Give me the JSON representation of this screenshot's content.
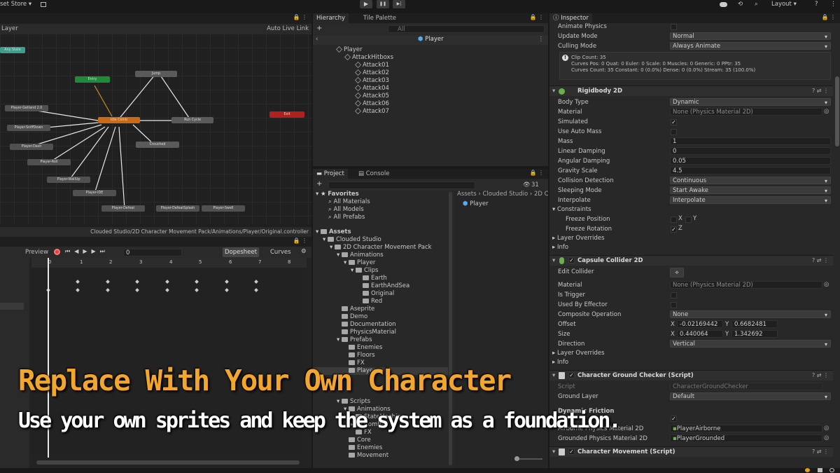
{
  "topbar": {
    "asset_store": "set Store ▾",
    "layout": "Layout ▾",
    "play_glyph": "▶",
    "pause_glyph": "❚❚",
    "step_glyph": "▶|"
  },
  "animator": {
    "layer_label": "Layer",
    "auto_live_link": "Auto Live Link",
    "path": "Clouded Studio/2D Character Movement Pack/Animations/Player/Original.controller",
    "nodes": {
      "any_state": "Any State",
      "entry": "Entry",
      "exit": "Exit",
      "idle": "Idle Comb",
      "jump": "Jump",
      "run_cycle": "Run Cycle",
      "crouched": "Crouched",
      "player_getdamaged": "Player-Getland 2.0",
      "player_sniffdown": "Player-SniffDown",
      "player_dash": "Player-Dash",
      "player_roll": "Player-Roll",
      "player_wallup": "Player-WallUp",
      "player_idle": "Player-IDE",
      "player_defeat": "Player-Defeat",
      "player_defeatsplash": "Player-DefeatSplash",
      "player_swell": "Player-Swell"
    }
  },
  "animation": {
    "preview_label": "Preview",
    "frame_value": "0",
    "dopesheet_label": "Dopesheet",
    "curves_label": "Curves",
    "ruler_ticks": [
      "0",
      "1",
      "2",
      "3",
      "4",
      "5",
      "6",
      "7",
      "8"
    ]
  },
  "hierarchy": {
    "tab_hierarchy": "Hierarchy",
    "tab_tile_palette": "Tile Palette",
    "search_placeholder": "All",
    "scene_title": "Player",
    "items": [
      "Player",
      "AttackHitboxs",
      "Attack01",
      "Attack02",
      "Attack03",
      "Attack04",
      "Attack05",
      "Attack06",
      "Attack07"
    ]
  },
  "project": {
    "tab_project": "Project",
    "tab_console": "Console",
    "hidden_count": "31",
    "favorites_label": "Favorites",
    "favorites": [
      "All Materials",
      "All Models",
      "All Prefabs"
    ],
    "assets_label": "Assets",
    "tree": [
      "Clouded Studio",
      "2D Character Movement Pack",
      "Animations",
      "Player",
      "Clips",
      "Earth",
      "EarthAndSea",
      "Original",
      "Red",
      "Aseprite",
      "Demo",
      "Documentation",
      "PhysicsMaterial",
      "Prefabs",
      "Enemies",
      "Floors",
      "FX",
      "Player",
      "Scripts",
      "Animations",
      "StateMachine",
      "Combat",
      "FX",
      "Core",
      "Enemies",
      "Movement"
    ],
    "breadcrumb": [
      "Assets",
      "Clouded Studio",
      "2D C"
    ],
    "content_item": "Player"
  },
  "inspector": {
    "tab_label": "Inspector",
    "animator_props": [
      {
        "label": "Animate Physics",
        "value": ""
      },
      {
        "label": "Update Mode",
        "value": "Normal"
      },
      {
        "label": "Culling Mode",
        "value": "Always Animate"
      }
    ],
    "clip_info": [
      "Clip Count: 35",
      "Curves Pos: 0 Quat: 0 Euler: 0 Scale: 0 Muscles: 0 Generic: 0 PPtr: 35",
      "Curves Count: 35 Constant: 0 (0.0%) Dense: 0 (0.0%) Stream: 35 (100.0%)"
    ],
    "rigidbody": {
      "title": "Rigidbody 2D",
      "body_type_label": "Body Type",
      "body_type": "Dynamic",
      "material_label": "Material",
      "material": "None (Physics Material 2D)",
      "simulated_label": "Simulated",
      "use_auto_mass_label": "Use Auto Mass",
      "mass_label": "Mass",
      "mass": "1",
      "linear_damping_label": "Linear Damping",
      "linear_damping": "0",
      "angular_damping_label": "Angular Damping",
      "angular_damping": "0.05",
      "gravity_scale_label": "Gravity Scale",
      "gravity_scale": "4.5",
      "collision_detection_label": "Collision Detection",
      "collision_detection": "Continuous",
      "sleeping_mode_label": "Sleeping Mode",
      "sleeping_mode": "Start Awake",
      "interpolate_label": "Interpolate",
      "interpolate": "Interpolate",
      "constraints_label": "Constraints",
      "freeze_position_label": "Freeze Position",
      "freeze_rotation_label": "Freeze Rotation",
      "x_label": "X",
      "y_label": "Y",
      "z_label": "Z",
      "layer_overrides_label": "Layer Overrides",
      "info_label": "Info"
    },
    "capsule": {
      "title": "Capsule Collider 2D",
      "edit_collider_label": "Edit Collider",
      "material_label": "Material",
      "material": "None (Physics Material 2D)",
      "is_trigger_label": "Is Trigger",
      "used_by_effector_label": "Used By Effector",
      "composite_label": "Composite Operation",
      "composite": "None",
      "offset_label": "Offset",
      "offset_x": "-0.02169442",
      "offset_y": "0.6682481",
      "size_label": "Size",
      "size_x": "0.440064",
      "size_y": "1.342692",
      "direction_label": "Direction",
      "direction": "Vertical",
      "x_label": "X",
      "y_label": "Y",
      "layer_overrides_label": "Layer Overrides",
      "info_label": "Info"
    },
    "ground_checker": {
      "title": "Character Ground Checker (Script)",
      "script_label": "Script",
      "script": "CharacterGroundChecker",
      "ground_layer_label": "Ground Layer",
      "ground_layer": "Default",
      "dynamic_friction_label": "Dynamic Friction",
      "airborne_label": "Airborne Physics Material 2D",
      "airborne": "PlayerAirborne",
      "grounded_label": "Grounded Physics Material 2D",
      "grounded": "PlayerGrounded"
    },
    "movement": {
      "title": "Character Movement (Script)"
    }
  },
  "overlay": {
    "title": "Replace With Your Own Character",
    "subtitle": "Use your own sprites and keep the system as a foundation."
  },
  "colors": {
    "accent_orange": "#f2a62d",
    "idle_node": "#c86a16",
    "entry_node": "#1e8a3a",
    "exit_node": "#b0201c",
    "any_state_node": "#3d9e8a"
  }
}
